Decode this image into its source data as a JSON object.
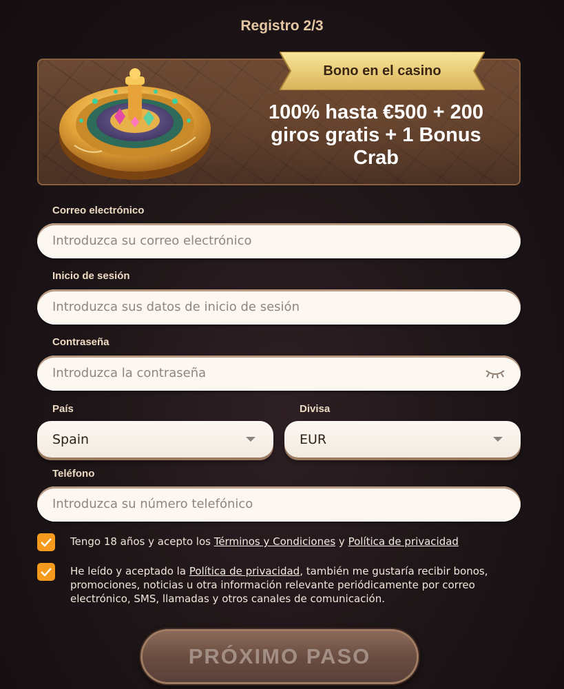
{
  "header": {
    "step_title": "Registro 2/3"
  },
  "bonus": {
    "ribbon_label": "Bono en el casino",
    "headline_line1": "100% hasta €500 + 200",
    "headline_line2": "giros gratis + 1 Bonus",
    "headline_line3": "Crab"
  },
  "form": {
    "email": {
      "label": "Correo electrónico",
      "placeholder": "Introduzca su correo electrónico",
      "value": ""
    },
    "login": {
      "label": "Inicio de sesión",
      "placeholder": "Introduzca sus datos de inicio de sesión",
      "value": ""
    },
    "password": {
      "label": "Contraseña",
      "placeholder": "Introduzca la contraseña",
      "value": "",
      "toggle_icon": "eye-closed-icon"
    },
    "country": {
      "label": "País",
      "value": "Spain"
    },
    "currency": {
      "label": "Divisa",
      "value": "EUR"
    },
    "phone": {
      "label": "Teléfono",
      "placeholder": "Introduzca su número telefónico",
      "value": ""
    }
  },
  "consents": {
    "age": {
      "checked": true,
      "text_before": "Tengo 18 años y acepto los ",
      "terms_link": "Términos y Condiciones",
      "text_middle": " y ",
      "privacy_link": "Política de privacidad"
    },
    "marketing": {
      "checked": true,
      "text_before": "He leído y aceptado la ",
      "privacy_link": "Política de privacidad",
      "text_after": ", también me gustaría recibir bonos, promociones, noticias u otra información relevante periódicamente por correo electrónico, SMS, llamadas y otros canales de comunicación."
    }
  },
  "actions": {
    "next_label": "PRÓXIMO PASO"
  },
  "colors": {
    "accent": "#f59a1c",
    "field_bg": "#fcf7f1",
    "banner": "#5a3d2b"
  }
}
